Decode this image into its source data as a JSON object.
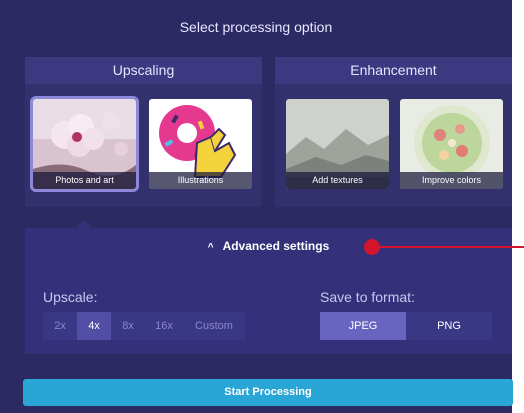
{
  "dialog": {
    "title": "Select processing option"
  },
  "upscaling": {
    "header": "Upscaling",
    "options": [
      {
        "label": "Photos and art",
        "selected": true
      },
      {
        "label": "Illustrations",
        "selected": false
      }
    ]
  },
  "enhancement": {
    "header": "Enhancement",
    "options": [
      {
        "label": "Add textures",
        "selected": false
      },
      {
        "label": "Improve colors",
        "selected": false
      }
    ]
  },
  "advanced": {
    "toggle_label": "Advanced settings",
    "toggle_icon": "chevron-up-icon",
    "upscale": {
      "label": "Upscale:",
      "options": [
        "2x",
        "4x",
        "8x",
        "16x",
        "Custom"
      ],
      "selected": "4x"
    },
    "format": {
      "label": "Save to format:",
      "options": [
        "JPEG",
        "PNG"
      ],
      "selected": "JPEG"
    }
  },
  "start_button": {
    "label": "Start Processing"
  },
  "colors": {
    "panel_bg": "#2c2a63",
    "accent_button": "#2aa6d6",
    "annotation_marker": "#d3142d"
  }
}
